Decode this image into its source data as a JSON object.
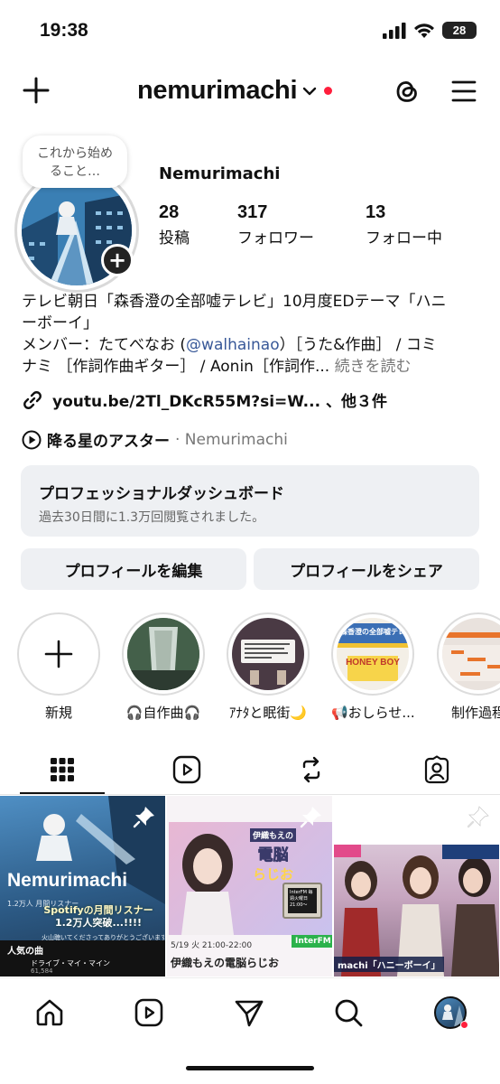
{
  "status_bar": {
    "time": "19:38",
    "battery": "28"
  },
  "header": {
    "username": "nemurimachi"
  },
  "profile": {
    "note": "これから始めること…",
    "note_line1": "これから始め",
    "note_line2": "ること…",
    "display_name": "Nemurimachi",
    "stats": [
      {
        "value": "28",
        "label": "投稿"
      },
      {
        "value": "317",
        "label": "フォロワー"
      },
      {
        "value": "13",
        "label": "フォロー中"
      }
    ],
    "bio_line1": "テレビ朝日「森香澄の全部嘘テレビ」10月度EDテーマ「ハニ",
    "bio_line2": "ーボーイ」",
    "bio_line3_prefix": "メンバー：たてべなお (",
    "bio_mention": "@walhainao",
    "bio_line3_suffix": "）［うた&作曲］ / コミ",
    "bio_line4": "ナミ ［作詞作曲ギター］ / Aonin［作詞作... ",
    "bio_more": "続きを読む",
    "link": "youtu.be/2Tl_DKcR55M?si=W... 、他３件",
    "music_song": "降る星のアスター",
    "music_artist": "· Nemurimachi"
  },
  "dashboard": {
    "title": "プロフェッショナルダッシュボード",
    "subtitle": "過去30日間に1.3万回閲覧されました。"
  },
  "buttons": {
    "edit": "プロフィールを編集",
    "share": "プロフィールをシェア"
  },
  "highlights": [
    {
      "label": "新規"
    },
    {
      "label": "🎧自作曲🎧"
    },
    {
      "label": "ｱﾅﾀと眠街🌙"
    },
    {
      "label": "📢おしらせ..."
    },
    {
      "label": "制作過程"
    }
  ],
  "highlight_texts": {
    "honey_boy": "HONEY BOY",
    "tv_title": "森香澄の全部嘘テレビ"
  },
  "posts": [
    {
      "artist": "Nemurimachi",
      "listeners": "1.2万人 月間リスナー",
      "banner": "Spotifyの月間リスナー 1.2万人突破...!!!!",
      "banner_line1": "Spotifyの月間リスナー",
      "banner_line2": "1.2万人突破...!!!!",
      "thanks": "火山聴いてくださってありがとうございます😊",
      "popular": "人気の曲",
      "track": "ドライブ・マイ・マイン",
      "plays": "61,584"
    },
    {
      "show": "伊織もえの電脳らじお",
      "logo_top": "伊織もえの",
      "logo_mid": "電脳",
      "logo_bottom": "らじお",
      "schedule": "5/19 火 21:00-22:00",
      "station": "InterFM",
      "monitor": "InterFM 毎週火曜日 21:00〜"
    },
    {
      "caption": "machi「ハニーボーイ」"
    }
  ],
  "colors": {
    "accent": "#385898",
    "notification": "#ff1e3c",
    "button_bg": "#eef0f3"
  }
}
